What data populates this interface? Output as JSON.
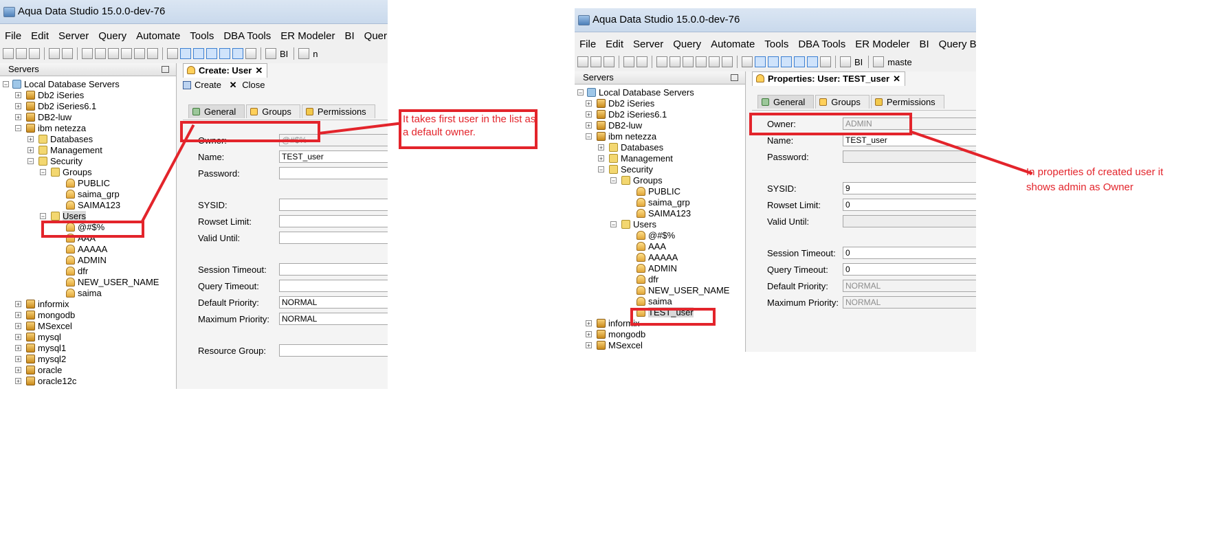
{
  "left": {
    "title": "Aqua Data Studio 15.0.0-dev-76",
    "menu": [
      "File",
      "Edit",
      "Server",
      "Query",
      "Automate",
      "Tools",
      "DBA Tools",
      "ER Modeler",
      "BI",
      "Quer"
    ],
    "toolbar": {
      "bi_label": "BI",
      "trailing_label": "n"
    },
    "servers_header": "Servers",
    "tree": {
      "root": "Local Database Servers",
      "db2_iseries": "Db2 iSeries",
      "db2_iseries61": "Db2 iSeries6.1",
      "db2_luw": "DB2-luw",
      "netezza": "ibm netezza",
      "databases": "Databases",
      "management": "Management",
      "security": "Security",
      "groups": "Groups",
      "group_items": [
        "PUBLIC",
        "saima_grp",
        "SAIMA123"
      ],
      "users": "Users",
      "user_items": [
        "@#$%",
        "AAA",
        "AAAAA",
        "ADMIN",
        "dfr",
        "NEW_USER_NAME",
        "saima"
      ],
      "other_servers": [
        "informix",
        "mongodb",
        "MSexcel",
        "mysql",
        "mysql1",
        "mysql2",
        "oracle",
        "oracle12c"
      ]
    },
    "editor": {
      "tab_title": "Create: User",
      "create_label": "Create",
      "close_label": "Close",
      "subtabs": [
        "General",
        "Groups",
        "Permissions"
      ],
      "fields": {
        "owner": {
          "label": "Owner:",
          "value": "@#$%"
        },
        "name": {
          "label": "Name:",
          "value": "TEST_user"
        },
        "password": {
          "label": "Password:",
          "value": ""
        },
        "sysid": {
          "label": "SYSID:",
          "value": ""
        },
        "rowset_limit": {
          "label": "Rowset Limit:",
          "value": ""
        },
        "valid_until": {
          "label": "Valid Until:",
          "value": ""
        },
        "session_timeout": {
          "label": "Session Timeout:",
          "value": ""
        },
        "query_timeout": {
          "label": "Query Timeout:",
          "value": ""
        },
        "default_priority": {
          "label": "Default Priority:",
          "value": "NORMAL"
        },
        "maximum_priority": {
          "label": "Maximum Priority:",
          "value": "NORMAL"
        },
        "resource_group": {
          "label": "Resource Group:",
          "value": ""
        }
      }
    }
  },
  "right": {
    "title": "Aqua Data Studio 15.0.0-dev-76",
    "menu": [
      "File",
      "Edit",
      "Server",
      "Query",
      "Automate",
      "Tools",
      "DBA Tools",
      "ER Modeler",
      "BI",
      "Query Bu"
    ],
    "toolbar": {
      "bi_label": "BI",
      "trailing_label": "maste"
    },
    "servers_header": "Servers",
    "tree": {
      "root": "Local Database Servers",
      "db2_iseries": "Db2 iSeries",
      "db2_iseries61": "Db2 iSeries6.1",
      "db2_luw": "DB2-luw",
      "netezza": "ibm netezza",
      "databases": "Databases",
      "management": "Management",
      "security": "Security",
      "groups": "Groups",
      "group_items": [
        "PUBLIC",
        "saima_grp",
        "SAIMA123"
      ],
      "users": "Users",
      "user_items": [
        "@#$%",
        "AAA",
        "AAAAA",
        "ADMIN",
        "dfr",
        "NEW_USER_NAME",
        "saima",
        "TEST_user"
      ],
      "other_servers": [
        "informix",
        "mongodb",
        "MSexcel"
      ]
    },
    "editor": {
      "tab_title": "Properties: User: TEST_user",
      "subtabs": [
        "General",
        "Groups",
        "Permissions"
      ],
      "fields": {
        "owner": {
          "label": "Owner:",
          "value": "ADMIN"
        },
        "name": {
          "label": "Name:",
          "value": "TEST_user"
        },
        "password": {
          "label": "Password:",
          "value": ""
        },
        "sysid": {
          "label": "SYSID:",
          "value": "9"
        },
        "rowset_limit": {
          "label": "Rowset Limit:",
          "value": "0"
        },
        "valid_until": {
          "label": "Valid Until:",
          "value": ""
        },
        "session_timeout": {
          "label": "Session Timeout:",
          "value": "0"
        },
        "query_timeout": {
          "label": "Query Timeout:",
          "value": "0"
        },
        "default_priority": {
          "label": "Default Priority:",
          "value": "NORMAL"
        },
        "maximum_priority": {
          "label": "Maximum Priority:",
          "value": "NORMAL"
        }
      }
    }
  },
  "annotations": {
    "note_left": "It takes first user in the list as a default owner.",
    "note_right": "In properties of created user it shows admin as Owner",
    "color": "#e3242b"
  }
}
